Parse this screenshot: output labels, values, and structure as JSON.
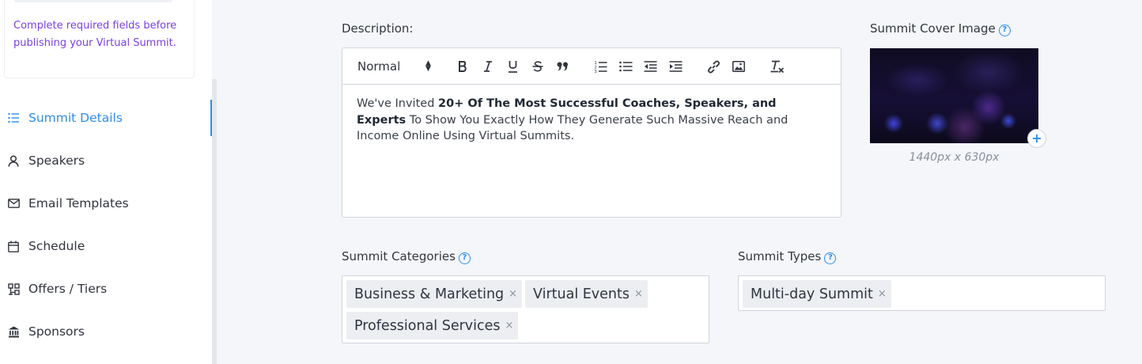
{
  "sidebar": {
    "notice": "Complete required fields before publishing your Virtual Summit.",
    "items": [
      {
        "label": "Summit Details",
        "icon": "list-icon",
        "active": true
      },
      {
        "label": "Speakers",
        "icon": "user-icon",
        "active": false
      },
      {
        "label": "Email Templates",
        "icon": "mail-icon",
        "active": false
      },
      {
        "label": "Schedule",
        "icon": "calendar-icon",
        "active": false
      },
      {
        "label": "Offers / Tiers",
        "icon": "tiers-icon",
        "active": false
      },
      {
        "label": "Sponsors",
        "icon": "bank-icon",
        "active": false
      }
    ]
  },
  "description": {
    "label": "Description:",
    "format_value": "Normal",
    "body_pre": "We've Invited ",
    "body_bold": "20+ Of The Most Successful Coaches, Speakers, and Experts",
    "body_post": " To Show You Exactly How They Generate Such Massive Reach and Income Online Using Virtual Summits."
  },
  "cover": {
    "label": "Summit Cover Image",
    "size": "1440px x 630px"
  },
  "categories": {
    "label": "Summit Categories",
    "tags": [
      "Business & Marketing",
      "Virtual Events",
      "Professional Services"
    ]
  },
  "types": {
    "label": "Summit Types",
    "tags": [
      "Multi-day Summit"
    ]
  },
  "colors": {
    "accent": "#2c8ef0",
    "notice": "#7b3fe4"
  }
}
